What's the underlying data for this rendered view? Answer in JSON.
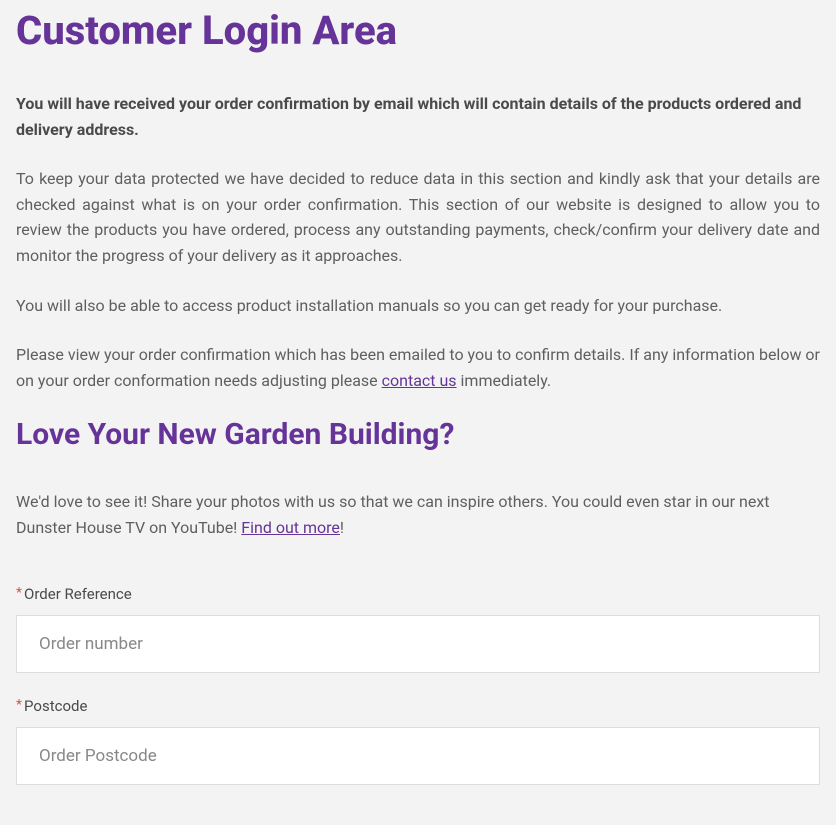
{
  "page": {
    "title": "Customer Login Area",
    "intro_paragraph": "You will have received your order confirmation by email which will contain details of the products ordered and delivery address.",
    "paragraph2": "To keep your data protected we have decided to reduce data in this section and kindly ask that your details are checked against what is on your order confirmation. This section of our website is designed to allow you to review the products you have ordered, process any outstanding payments, check/confirm your delivery date and monitor the progress of your delivery as it approaches.",
    "paragraph3": "You will also be able to access product installation manuals so you can get ready for your purchase.",
    "paragraph4_pre": "Please view your order confirmation which has been emailed to you to confirm details. If any information below or on your order conformation needs adjusting please ",
    "paragraph4_link": "contact us",
    "paragraph4_post": " immediately.",
    "subheading": "Love Your New Garden Building?",
    "love_pre": "We'd love to see it! Share your photos with us so that we can inspire others. You could even star in our next Dunster House TV on YouTube! ",
    "love_link": "Find out more",
    "love_post": "!"
  },
  "form": {
    "order_reference": {
      "label": "Order Reference",
      "placeholder": "Order number",
      "required": "*"
    },
    "postcode": {
      "label": "Postcode",
      "placeholder": "Order Postcode",
      "required": "*"
    }
  }
}
